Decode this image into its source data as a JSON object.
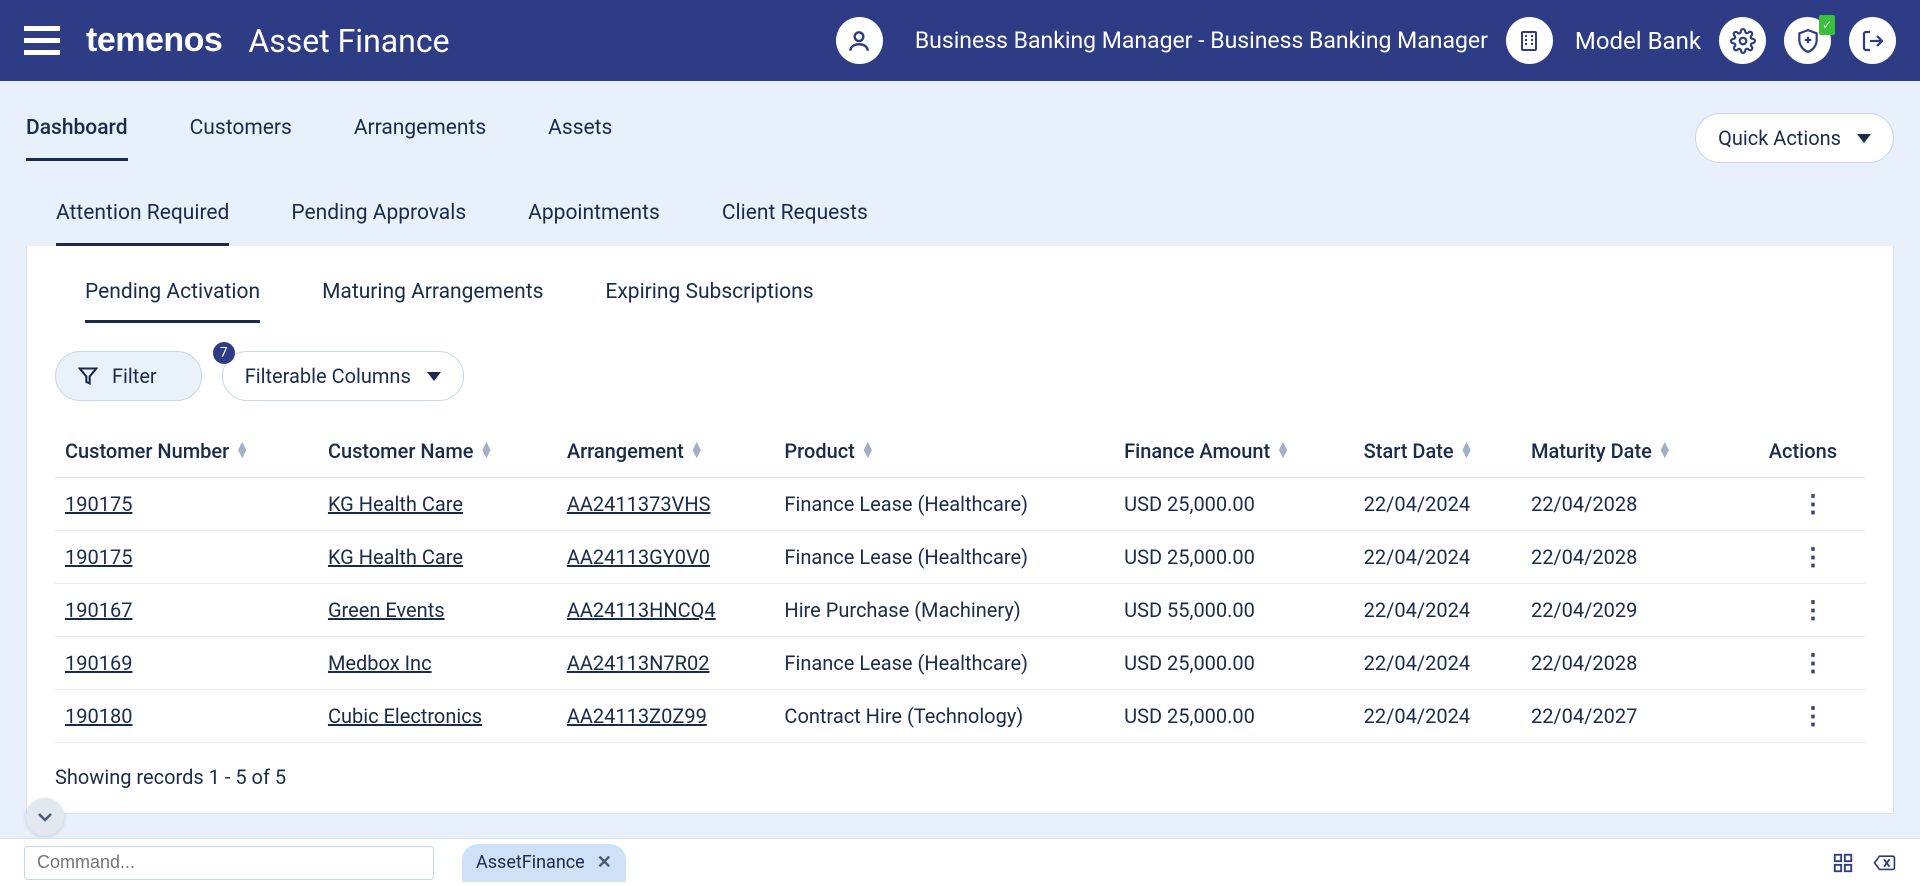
{
  "header": {
    "brand": "temenos",
    "app_title": "Asset Finance",
    "role": "Business Banking Manager - Business Banking Manager",
    "bank": "Model Bank"
  },
  "nav": {
    "tabs": [
      "Dashboard",
      "Customers",
      "Arrangements",
      "Assets"
    ],
    "active": 0,
    "quick_actions": "Quick Actions"
  },
  "sub_nav": {
    "tabs": [
      "Attention Required",
      "Pending Approvals",
      "Appointments",
      "Client Requests"
    ],
    "active": 0
  },
  "panel_tabs": {
    "tabs": [
      "Pending Activation",
      "Maturing Arrangements",
      "Expiring Subscriptions"
    ],
    "active": 0
  },
  "filters": {
    "filter_label": "Filter",
    "filterable_label": "Filterable Columns",
    "badge": "7"
  },
  "table": {
    "columns": [
      "Customer Number",
      "Customer Name",
      "Arrangement",
      "Product",
      "Finance Amount",
      "Start Date",
      "Maturity Date",
      "Actions"
    ],
    "rows": [
      {
        "customer_number": "190175",
        "customer_name": "KG Health Care",
        "arrangement": "AA2411373VHS",
        "product": "Finance Lease (Healthcare)",
        "finance_amount": "USD 25,000.00",
        "start_date": "22/04/2024",
        "maturity_date": "22/04/2028"
      },
      {
        "customer_number": "190175",
        "customer_name": "KG Health Care",
        "arrangement": "AA24113GY0V0",
        "product": "Finance Lease (Healthcare)",
        "finance_amount": "USD 25,000.00",
        "start_date": "22/04/2024",
        "maturity_date": "22/04/2028"
      },
      {
        "customer_number": "190167",
        "customer_name": "Green Events",
        "arrangement": "AA24113HNCQ4",
        "product": "Hire Purchase (Machinery)",
        "finance_amount": "USD 55,000.00",
        "start_date": "22/04/2024",
        "maturity_date": "22/04/2029"
      },
      {
        "customer_number": "190169",
        "customer_name": "Medbox Inc",
        "arrangement": "AA24113N7R02",
        "product": "Finance Lease (Healthcare)",
        "finance_amount": "USD 25,000.00",
        "start_date": "22/04/2024",
        "maturity_date": "22/04/2028"
      },
      {
        "customer_number": "190180",
        "customer_name": "Cubic Electronics",
        "arrangement": "AA24113Z0Z99",
        "product": "Contract Hire (Technology)",
        "finance_amount": "USD 25,000.00",
        "start_date": "22/04/2024",
        "maturity_date": "22/04/2027"
      }
    ],
    "records_text": "Showing records 1 - 5 of 5"
  },
  "footer": {
    "command_placeholder": "Command...",
    "tab_label": "AssetFinance"
  }
}
